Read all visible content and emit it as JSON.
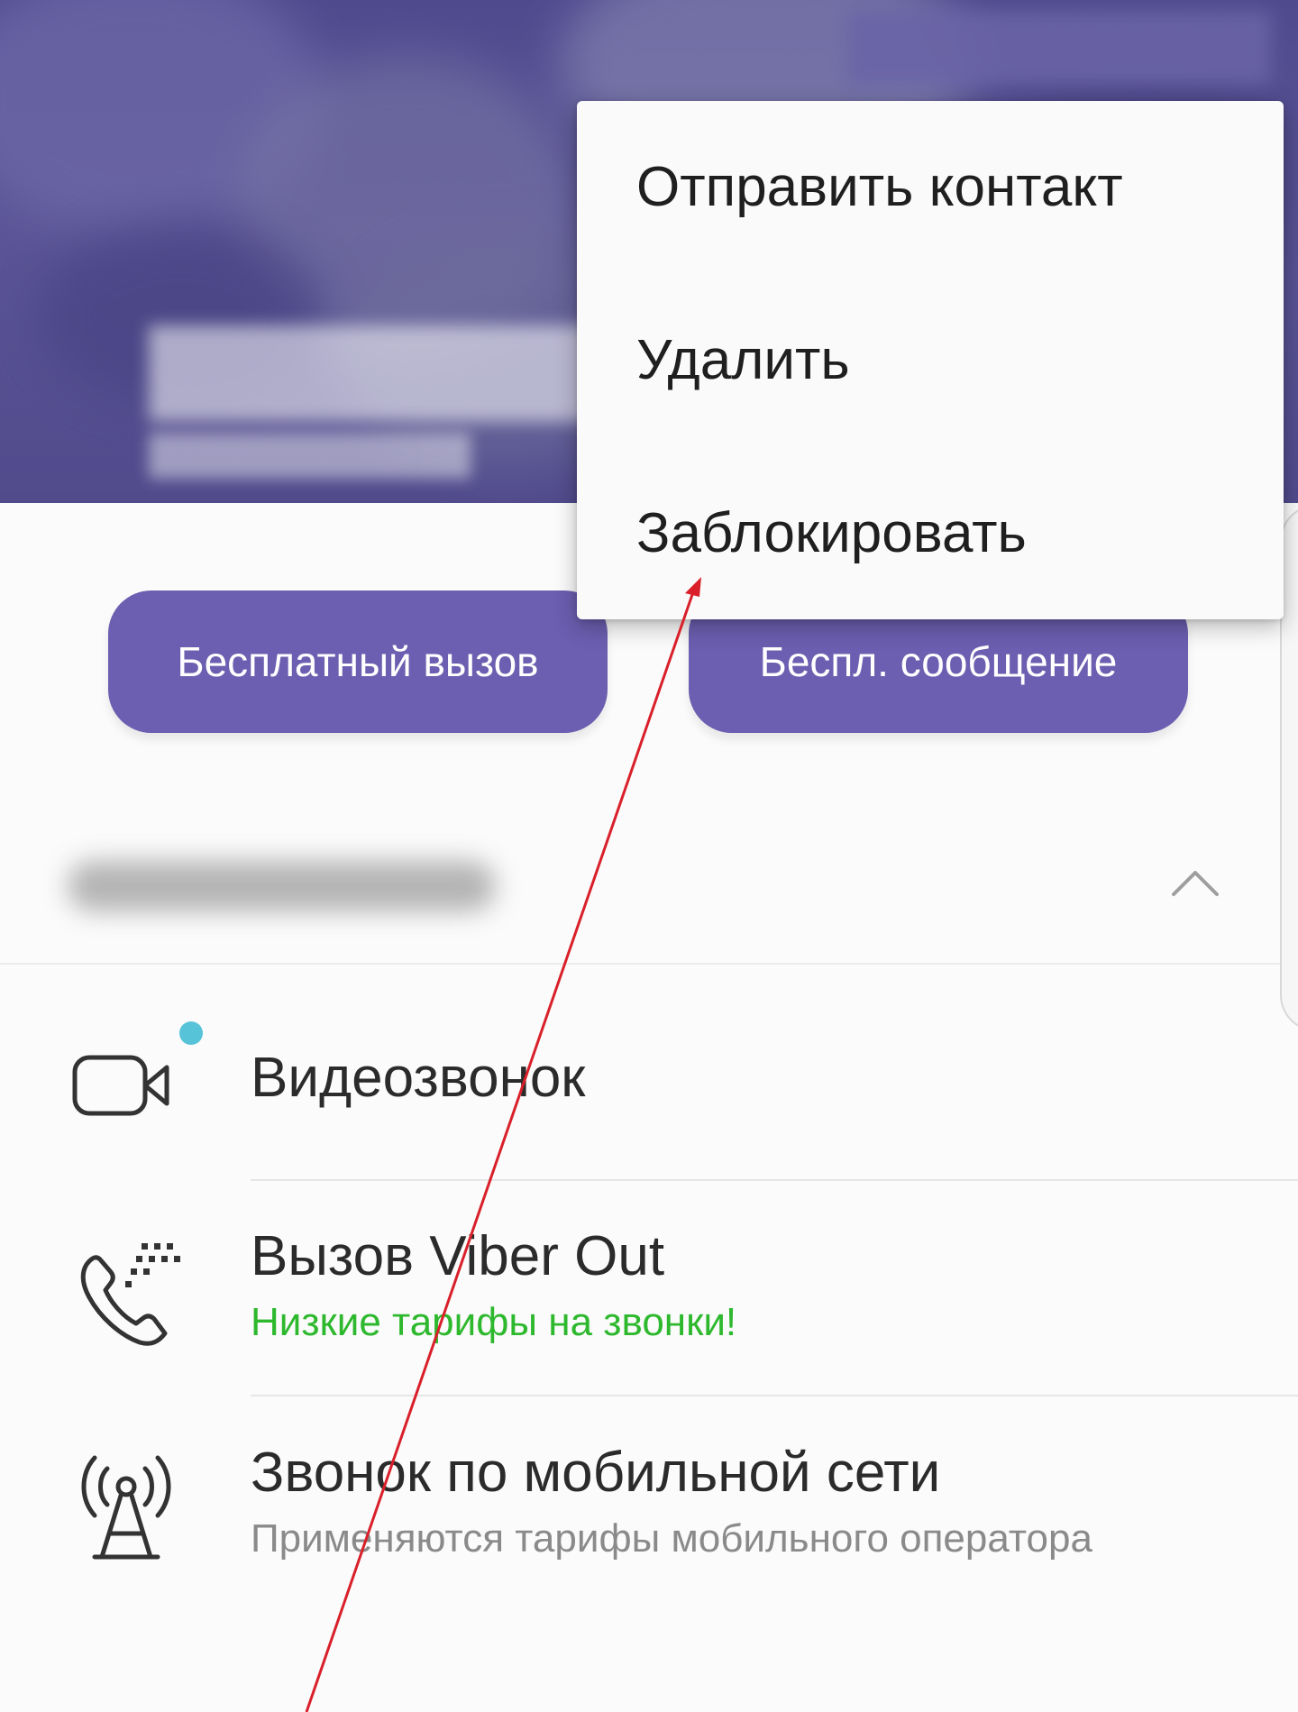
{
  "colors": {
    "header_bg": "#55508f",
    "button_bg": "#6c5eb0",
    "button_text": "#ffffff",
    "promo_green": "#2db82d",
    "secondary_gray": "#8a8a8a",
    "badge_cyan": "#56c3d9",
    "annotation_red": "#d9202a"
  },
  "actions": {
    "free_call_label": "Бесплатный вызов",
    "free_message_label": "Беспл. сообщение"
  },
  "popup_menu": {
    "items": [
      {
        "label": "Отправить контакт"
      },
      {
        "label": "Удалить"
      },
      {
        "label": "Заблокировать"
      }
    ]
  },
  "call_options": {
    "video_call": {
      "title": "Видеозвонок",
      "icon": "video-camera-icon",
      "has_badge": true
    },
    "viber_out": {
      "title": "Вызов Viber Out",
      "subtitle": "Низкие тарифы на звонки!",
      "icon": "phone-dialpad-icon"
    },
    "mobile_call": {
      "title": "Звонок по мобильной сети",
      "subtitle": "Применяются тарифы мобильного оператора",
      "icon": "cell-tower-icon"
    }
  },
  "icons": {
    "collapse": "chevron-up-icon"
  }
}
